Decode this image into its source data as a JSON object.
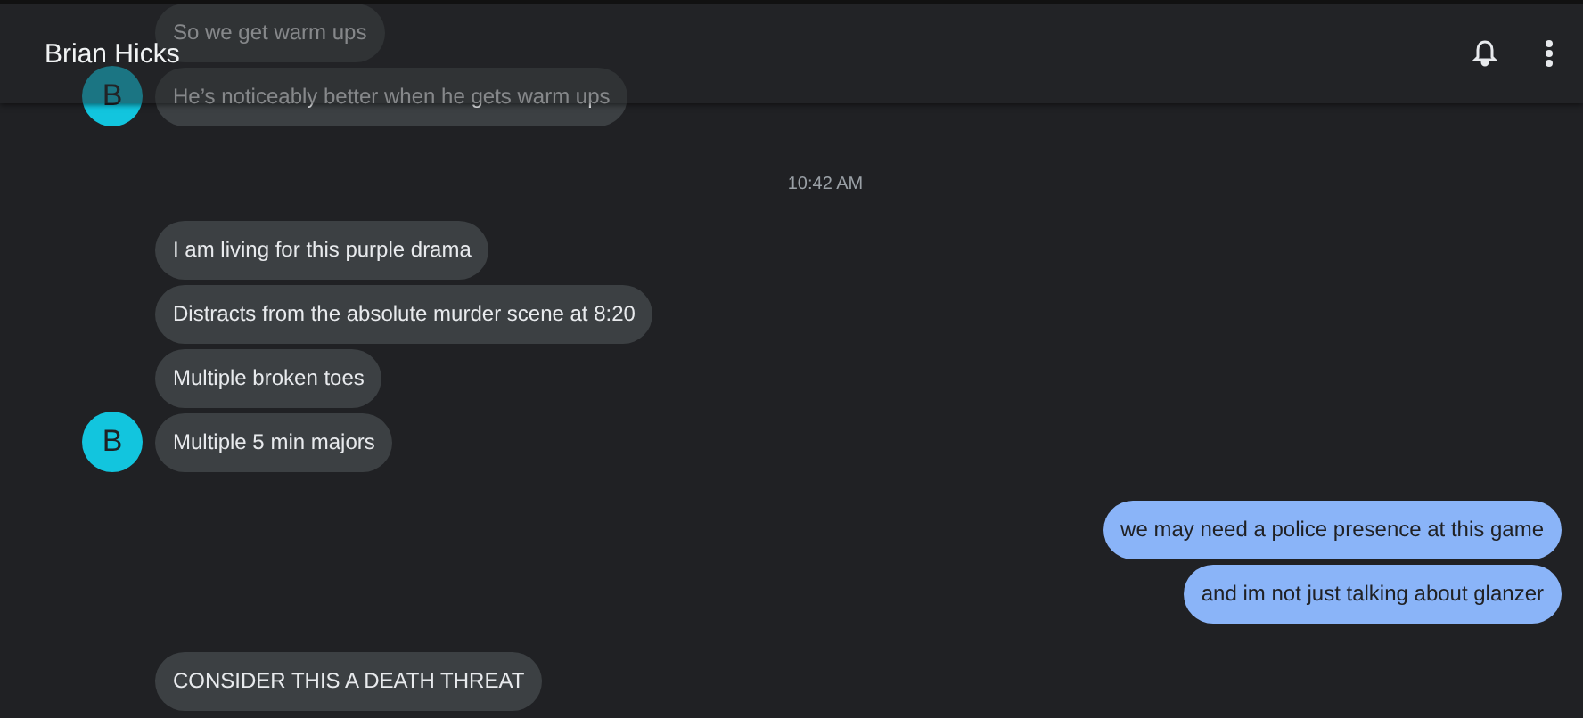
{
  "header": {
    "title": "Brian Hicks"
  },
  "thread": [
    {
      "kind": "incoming",
      "avatar": "B",
      "bubbles": [
        "So we get warm ups",
        "He’s noticeably better when he gets warm ups"
      ]
    },
    {
      "kind": "timestamp",
      "text": "10:42 AM"
    },
    {
      "kind": "incoming",
      "avatar": "B",
      "bubbles": [
        "I am living for this purple drama",
        "Distracts from the absolute murder scene at 8:20",
        "Multiple broken toes",
        "Multiple 5 min majors"
      ]
    },
    {
      "kind": "outgoing",
      "bubbles": [
        "we may need a police presence at this game",
        "and im not just talking about glanzer"
      ]
    },
    {
      "kind": "incoming",
      "bubbles": [
        "CONSIDER THIS A DEATH THREAT"
      ]
    }
  ]
}
